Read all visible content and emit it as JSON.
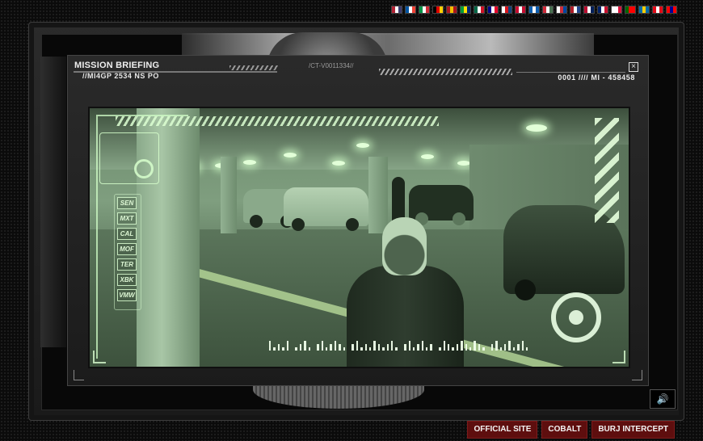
{
  "flags": [
    {
      "name": "usa-flag-icon",
      "colors": [
        "#b22234",
        "#ffffff",
        "#3c3b6e"
      ]
    },
    {
      "name": "france-flag-icon",
      "colors": [
        "#0055a4",
        "#ffffff",
        "#ef4135"
      ]
    },
    {
      "name": "italy-flag-icon",
      "colors": [
        "#009246",
        "#ffffff",
        "#ce2b37"
      ]
    },
    {
      "name": "germany-flag-icon",
      "colors": [
        "#000000",
        "#dd0000",
        "#ffce00"
      ]
    },
    {
      "name": "spain-flag-icon",
      "colors": [
        "#aa151b",
        "#f1bf00",
        "#aa151b"
      ]
    },
    {
      "name": "brazil-flag-icon",
      "colors": [
        "#009c3b",
        "#ffdf00",
        "#002776"
      ]
    },
    {
      "name": "mexico-flag-icon",
      "colors": [
        "#006847",
        "#ffffff",
        "#ce1126"
      ]
    },
    {
      "name": "australia-flag-icon",
      "colors": [
        "#00008b",
        "#ffffff",
        "#e4002b"
      ]
    },
    {
      "name": "czech-flag-icon",
      "colors": [
        "#ffffff",
        "#d7141a",
        "#11457e"
      ]
    },
    {
      "name": "denmark-flag-icon",
      "colors": [
        "#c60c30",
        "#ffffff",
        "#c60c30"
      ]
    },
    {
      "name": "greece-flag-icon",
      "colors": [
        "#0d5eaf",
        "#ffffff",
        "#0d5eaf"
      ]
    },
    {
      "name": "hungary-flag-icon",
      "colors": [
        "#ce2939",
        "#ffffff",
        "#477050"
      ]
    },
    {
      "name": "korea-flag-icon",
      "colors": [
        "#ffffff",
        "#cd2e3a",
        "#0047a0"
      ]
    },
    {
      "name": "netherlands-flag-icon",
      "colors": [
        "#ae1c28",
        "#ffffff",
        "#21468b"
      ]
    },
    {
      "name": "norway-flag-icon",
      "colors": [
        "#ba0c2f",
        "#ffffff",
        "#00205b"
      ]
    },
    {
      "name": "new-zealand-flag-icon",
      "colors": [
        "#012169",
        "#ffffff",
        "#c8102e"
      ]
    },
    {
      "name": "poland-flag-icon",
      "colors": [
        "#ffffff",
        "#ffffff",
        "#dc143c"
      ]
    },
    {
      "name": "portugal-flag-icon",
      "colors": [
        "#006600",
        "#ff0000",
        "#ff0000"
      ]
    },
    {
      "name": "sweden-flag-icon",
      "colors": [
        "#006aa7",
        "#fecc00",
        "#006aa7"
      ]
    },
    {
      "name": "turkey-flag-icon",
      "colors": [
        "#e30a17",
        "#ffffff",
        "#e30a17"
      ]
    },
    {
      "name": "taiwan-flag-icon",
      "colors": [
        "#fe0000",
        "#000095",
        "#fe0000"
      ]
    }
  ],
  "briefing": {
    "title": "MISSION BRIEFING",
    "subtitle": "//MI4GP 2534 NS PO",
    "code": "/CT-V0011334//",
    "counter": "0001 //// MI - 458458",
    "close_glyph": "×"
  },
  "hud": {
    "codes": [
      "SEN",
      "MXT",
      "CAL",
      "MOF",
      "TER",
      "XBK",
      "VMW"
    ],
    "progress": [
      3,
      1,
      2,
      1,
      3,
      0,
      1,
      2,
      3,
      1,
      0,
      2,
      3,
      1,
      2,
      3,
      2,
      1,
      0,
      2,
      3,
      1,
      2,
      1,
      3,
      2,
      1,
      2,
      3,
      1,
      0,
      2,
      3,
      1,
      2,
      3,
      1,
      2,
      0,
      1,
      3,
      2,
      1,
      2,
      3,
      2,
      1,
      3,
      2,
      1,
      0,
      2,
      3,
      1,
      2,
      3,
      1,
      2,
      3,
      1
    ]
  },
  "sound_glyph": "🔊",
  "footer": {
    "links": [
      "OFFICIAL SITE",
      "COBALT",
      "BURJ INTERCEPT"
    ]
  }
}
